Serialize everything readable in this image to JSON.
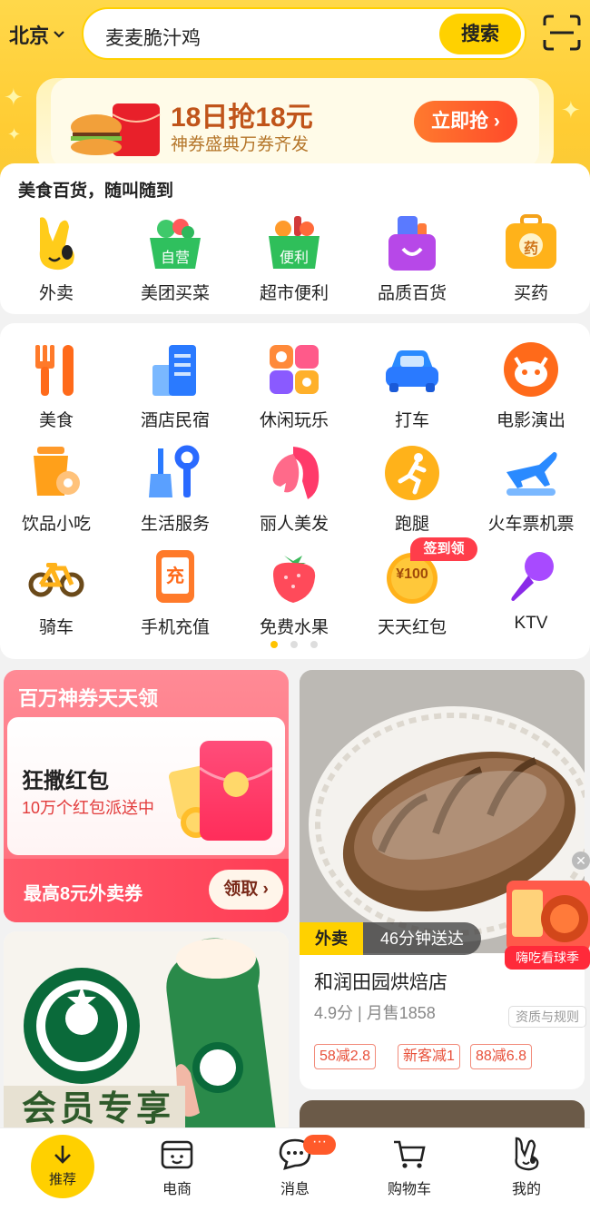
{
  "header": {
    "city": "北京",
    "search_text": "麦麦脆汁鸡",
    "search_button": "搜索"
  },
  "promo": {
    "title": "18日抢18元",
    "subtitle": "神券盛典万券齐发",
    "button": "立即抢"
  },
  "section1": {
    "title": "美食百货，随叫随到",
    "items": [
      {
        "label": "外卖",
        "icon": "rabbit-icon",
        "badge": ""
      },
      {
        "label": "美团买菜",
        "icon": "vegetable-basket-icon",
        "badge": "自营"
      },
      {
        "label": "超市便利",
        "icon": "supermarket-basket-icon",
        "badge": "便利"
      },
      {
        "label": "品质百货",
        "icon": "shopping-bag-icon",
        "badge": ""
      },
      {
        "label": "买药",
        "icon": "medicine-box-icon",
        "badge": "药"
      }
    ]
  },
  "grid": {
    "items": [
      {
        "label": "美食",
        "icon": "fork-knife-icon"
      },
      {
        "label": "酒店民宿",
        "icon": "hotel-icon"
      },
      {
        "label": "休闲玩乐",
        "icon": "leisure-icon"
      },
      {
        "label": "打车",
        "icon": "car-icon"
      },
      {
        "label": "电影演出",
        "icon": "cat-movie-icon"
      },
      {
        "label": "饮品小吃",
        "icon": "drink-icon"
      },
      {
        "label": "生活服务",
        "icon": "tools-icon"
      },
      {
        "label": "丽人美发",
        "icon": "hair-icon"
      },
      {
        "label": "跑腿",
        "icon": "runner-icon"
      },
      {
        "label": "火车票机票",
        "icon": "plane-icon"
      },
      {
        "label": "骑车",
        "icon": "bicycle-icon"
      },
      {
        "label": "手机充值",
        "icon": "phone-recharge-icon"
      },
      {
        "label": "免费水果",
        "icon": "strawberry-icon"
      },
      {
        "label": "天天红包",
        "icon": "coin-icon"
      },
      {
        "label": "KTV",
        "icon": "microphone-icon"
      }
    ],
    "recharge_glyph": "充",
    "coin_text": "¥100",
    "sign_badge": "签到领",
    "page_count": 3,
    "active_page": 1
  },
  "coupon": {
    "header": "百万神券天天领",
    "main": "狂撒红包",
    "sub": "10万个红包派送中",
    "footer": "最高8元外卖券",
    "button": "领取"
  },
  "starbucks": {
    "banner": "会员专享"
  },
  "shop": {
    "tag": "外卖",
    "delivery": "46分钟送达",
    "name": "和润田园烘焙店",
    "rating": "4.9分 | 月售1858",
    "qualification": "资质与规则",
    "discounts": [
      "58减2.8",
      "新客减1",
      "88减6.8"
    ],
    "float_ad": "嗨吃看球季"
  },
  "tabbar": {
    "items": [
      {
        "label": "推荐"
      },
      {
        "label": "电商"
      },
      {
        "label": "消息"
      },
      {
        "label": "购物车"
      },
      {
        "label": "我的"
      }
    ],
    "msg_badge": "···"
  },
  "colors": {
    "brand_yellow": "#ffd100",
    "accent_red": "#ff3d55",
    "accent_orange": "#ff6a2a"
  }
}
